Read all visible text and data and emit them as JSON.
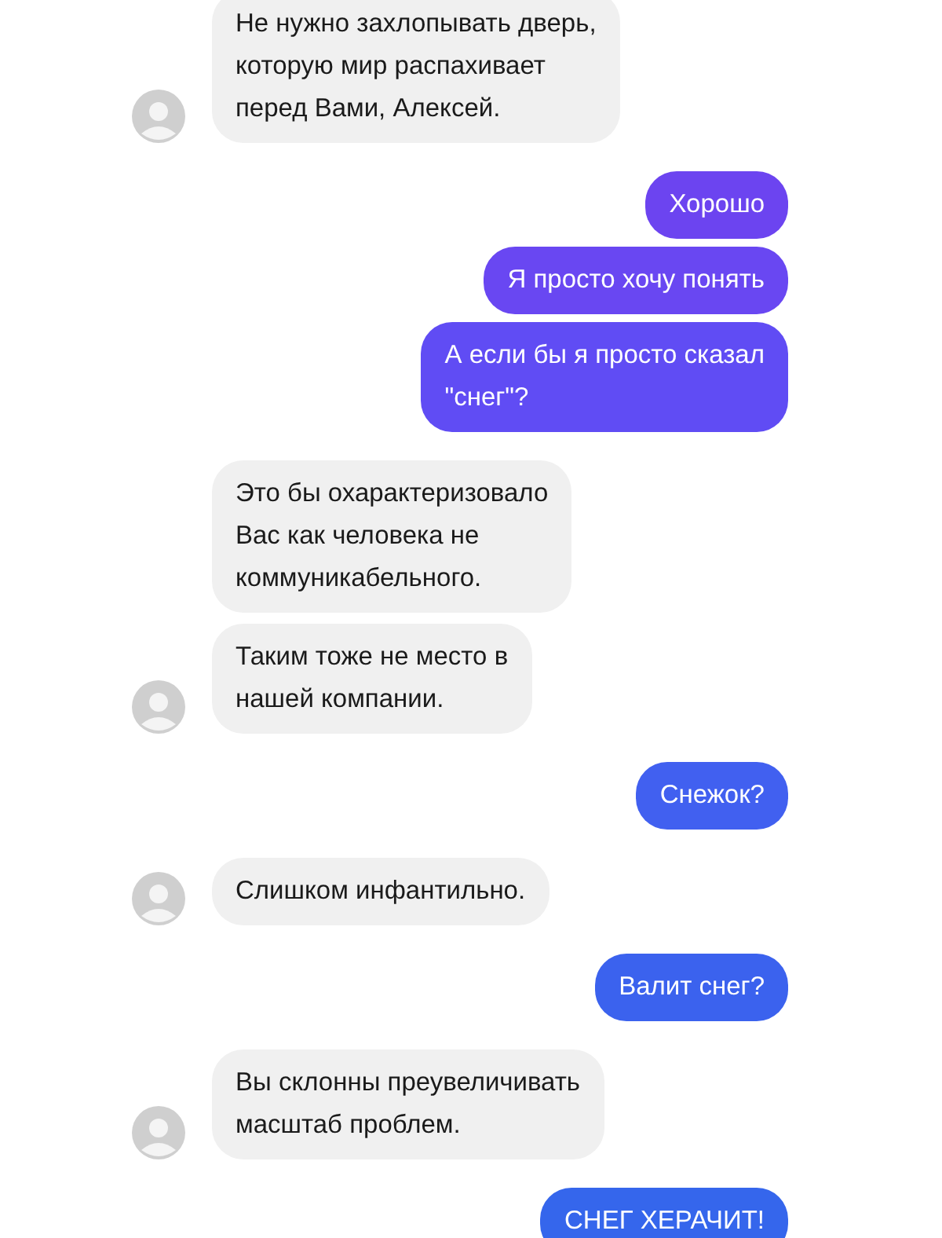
{
  "groups": [
    {
      "kind": "incoming",
      "messages": [
        {
          "text": "Не нужно захлопывать дверь,\nкоторую мир распахивает\nперед Вами, Алексей."
        }
      ]
    },
    {
      "kind": "outgoing",
      "messages": [
        {
          "text": "Хорошо",
          "color": "#6c44f0"
        },
        {
          "text": "Я просто хочу понять",
          "color": "#6947f2"
        },
        {
          "text": "А если бы я просто сказал\n\"снег\"?",
          "color": "#604cf4"
        }
      ]
    },
    {
      "kind": "incoming",
      "messages": [
        {
          "text": "Это бы охарактеризовало\nВас как человека не\nкоммуникабельного."
        },
        {
          "text": "Таким тоже не место в\nнашей компании."
        }
      ]
    },
    {
      "kind": "outgoing",
      "messages": [
        {
          "text": "Снежок?",
          "color": "#4160f0"
        }
      ]
    },
    {
      "kind": "incoming",
      "messages": [
        {
          "text": "Слишком инфантильно."
        }
      ]
    },
    {
      "kind": "outgoing",
      "messages": [
        {
          "text": "Валит снег?",
          "color": "#3b62ee"
        }
      ]
    },
    {
      "kind": "incoming",
      "messages": [
        {
          "text": "Вы склонны преувеличивать\nмасштаб проблем."
        }
      ]
    },
    {
      "kind": "outgoing",
      "messages": [
        {
          "text": "СНЕГ ХЕРАЧИТ!",
          "color": "#3566ec"
        }
      ]
    }
  ]
}
